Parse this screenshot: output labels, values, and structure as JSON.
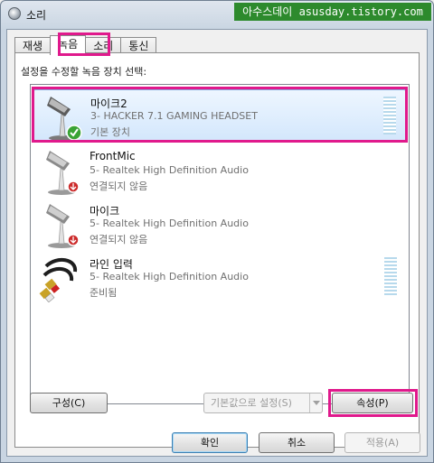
{
  "window": {
    "title": "소리",
    "watermark": "아수스데이 asusday.tistory.com"
  },
  "tabs": [
    {
      "label": "재생"
    },
    {
      "label": "녹음",
      "active": true
    },
    {
      "label": "소리"
    },
    {
      "label": "통신"
    }
  ],
  "instruction": "설정을 수정할 녹음 장치 선택:",
  "devices": [
    {
      "name": "마이크2",
      "description": "3- HACKER 7.1 GAMING HEADSET",
      "status": "기본 장치",
      "icon": "microphone-icon",
      "badge": "default-check-icon",
      "selected": true
    },
    {
      "name": "FrontMic",
      "description": "5- Realtek High Definition Audio",
      "status": "연결되지 않음",
      "icon": "microphone-icon",
      "badge": "unplugged-icon"
    },
    {
      "name": "마이크",
      "description": "5- Realtek High Definition Audio",
      "status": "연결되지 않음",
      "icon": "microphone-icon",
      "badge": "unplugged-icon"
    },
    {
      "name": "라인 입력",
      "description": "5- Realtek High Definition Audio",
      "status": "준비됨",
      "icon": "rca-cable-icon"
    }
  ],
  "buttons": {
    "configure": "구성(C)",
    "set_default": "기본값으로 설정(S)",
    "properties": "속성(P)",
    "ok": "확인",
    "cancel": "취소",
    "apply": "적용(A)"
  },
  "colors": {
    "highlight": "#e0198c",
    "watermark_bg": "#2d8a2d",
    "selection": "#d3e7fc",
    "level_meter": "#b7d9ec"
  }
}
